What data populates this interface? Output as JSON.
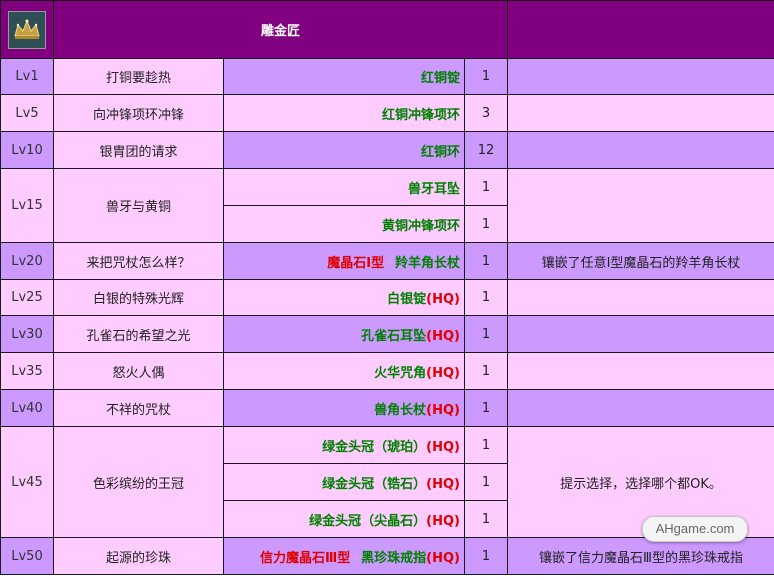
{
  "header": {
    "title": "雕金匠",
    "icon": "crown-icon"
  },
  "colors": {
    "header_bg": "#800080",
    "dark_row": "#cc99ff",
    "light_row": "#ffccff",
    "item_green": "#008000",
    "hq_red": "#e00000"
  },
  "rows": [
    {
      "level": "Lv1",
      "quest": "打铜要趁热",
      "item": [
        {
          "t": "红铜锭",
          "c": "green"
        }
      ],
      "count": "1",
      "note": ""
    },
    {
      "level": "Lv5",
      "quest": "向冲锋项环冲锋",
      "item": [
        {
          "t": "红铜冲锋项环",
          "c": "green"
        }
      ],
      "count": "3",
      "note": ""
    },
    {
      "level": "Lv10",
      "quest": "银胄团的请求",
      "item": [
        {
          "t": "红铜环",
          "c": "green"
        }
      ],
      "count": "12",
      "note": ""
    },
    {
      "level": "Lv15",
      "quest": "兽牙与黄铜",
      "items": [
        {
          "item": [
            {
              "t": "兽牙耳坠",
              "c": "green"
            }
          ],
          "count": "1"
        },
        {
          "item": [
            {
              "t": "黄铜冲锋项环",
              "c": "green"
            }
          ],
          "count": "1"
        }
      ],
      "note": ""
    },
    {
      "level": "Lv20",
      "quest": "来把咒杖怎么样？",
      "item": [
        {
          "t": "魔晶石Ⅰ型",
          "c": "red"
        },
        {
          "t": "+",
          "c": "plus"
        },
        {
          "t": "羚羊角长杖",
          "c": "green"
        }
      ],
      "count": "1",
      "note": "镶嵌了任意Ⅰ型魔晶石的羚羊角长杖"
    },
    {
      "level": "Lv25",
      "quest": "白银的特殊光辉",
      "item": [
        {
          "t": "白银锭",
          "c": "green"
        },
        {
          "t": "(HQ)",
          "c": "red"
        }
      ],
      "count": "1",
      "note": ""
    },
    {
      "level": "Lv30",
      "quest": "孔雀石的希望之光",
      "item": [
        {
          "t": "孔雀石耳坠",
          "c": "green"
        },
        {
          "t": "(HQ)",
          "c": "red"
        }
      ],
      "count": "1",
      "note": ""
    },
    {
      "level": "Lv35",
      "quest": "怒火人偶",
      "item": [
        {
          "t": "火华咒角",
          "c": "green"
        },
        {
          "t": "(HQ)",
          "c": "red"
        }
      ],
      "count": "1",
      "note": ""
    },
    {
      "level": "Lv40",
      "quest": "不祥的咒杖",
      "item": [
        {
          "t": "兽角长杖",
          "c": "green"
        },
        {
          "t": "(HQ)",
          "c": "red"
        }
      ],
      "count": "1",
      "note": ""
    },
    {
      "level": "Lv45",
      "quest": "色彩缤纷的王冠",
      "items": [
        {
          "item": [
            {
              "t": "绿金头冠（琥珀）",
              "c": "green"
            },
            {
              "t": "(HQ)",
              "c": "red"
            }
          ],
          "count": "1"
        },
        {
          "item": [
            {
              "t": "绿金头冠（锆石）",
              "c": "green"
            },
            {
              "t": "(HQ)",
              "c": "red"
            }
          ],
          "count": "1"
        },
        {
          "item": [
            {
              "t": "绿金头冠（尖晶石）",
              "c": "green"
            },
            {
              "t": "(HQ)",
              "c": "red"
            }
          ],
          "count": "1"
        }
      ],
      "note": "提示选择，选择哪个都OK。"
    },
    {
      "level": "Lv50",
      "quest": "起源的珍珠",
      "item": [
        {
          "t": "信力魔晶石Ⅲ型",
          "c": "red"
        },
        {
          "t": "+",
          "c": "plus"
        },
        {
          "t": "黑珍珠戒指",
          "c": "green"
        },
        {
          "t": "(HQ)",
          "c": "red"
        }
      ],
      "count": "1",
      "note": "镶嵌了信力魔晶石Ⅲ型的黑珍珠戒指"
    }
  ],
  "watermark": "AHgame.com"
}
